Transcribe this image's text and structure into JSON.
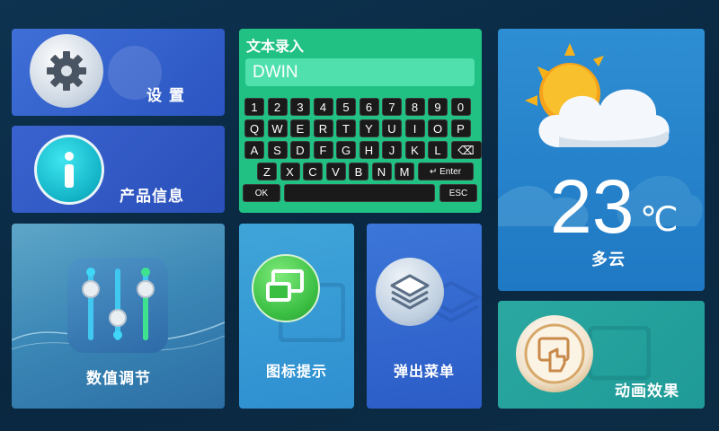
{
  "tiles": {
    "settings": {
      "label": "设 置",
      "icon": "gear-icon"
    },
    "info": {
      "label": "产品信息",
      "icon": "info-icon"
    },
    "value": {
      "label": "数值调节",
      "icon": "sliders-icon"
    },
    "icon_hint": {
      "label": "图标提示",
      "icon": "window-icon"
    },
    "popup": {
      "label": "弹出菜单",
      "icon": "layers-icon"
    },
    "anim": {
      "label": "动画效果",
      "icon": "touch-icon"
    }
  },
  "keyboard": {
    "title": "文本录入",
    "input_value": "DWIN",
    "row1": [
      "1",
      "2",
      "3",
      "4",
      "5",
      "6",
      "7",
      "8",
      "9",
      "0"
    ],
    "row2": [
      "Q",
      "W",
      "E",
      "R",
      "T",
      "Y",
      "U",
      "I",
      "O",
      "P"
    ],
    "row3": [
      "A",
      "S",
      "D",
      "F",
      "G",
      "H",
      "J",
      "K",
      "L",
      "⌫"
    ],
    "row4": [
      "Z",
      "X",
      "C",
      "V",
      "B",
      "N",
      "M",
      "↵ Enter"
    ],
    "ok": "OK",
    "esc": "ESC"
  },
  "weather": {
    "temp": "23",
    "unit": "℃",
    "condition": "多云",
    "icon": "partly-cloudy-icon"
  },
  "colors": {
    "keyboard_bg": "#21c184",
    "input_bg": "#4fe0ae",
    "accent_blue": "#2b55c2"
  }
}
